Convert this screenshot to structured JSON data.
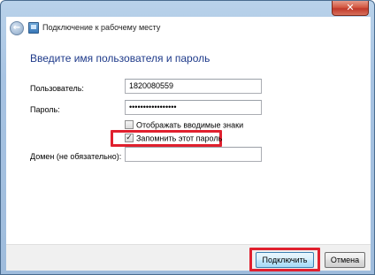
{
  "window": {
    "close_glyph": "✕"
  },
  "header": {
    "back_glyph": "←",
    "title": "Подключение к рабочему месту"
  },
  "main": {
    "heading": "Введите имя пользователя и пароль",
    "username_label": "Пользователь:",
    "username_value": "1820080559",
    "password_label": "Пароль:",
    "password_value": "•••••••••••••••••",
    "show_chars_label": "Отображать вводимые знаки",
    "show_chars_checked": false,
    "remember_label": "Запомнить этот пароль",
    "remember_checked": true,
    "remember_check_glyph": "✓",
    "domain_label": "Домен (не обязательно):",
    "domain_value": ""
  },
  "footer": {
    "connect_label": "Подключить",
    "cancel_label": "Отмена"
  },
  "colors": {
    "heading": "#1e3a8a",
    "highlight": "#e0202e",
    "close_button": "#c0392b"
  }
}
